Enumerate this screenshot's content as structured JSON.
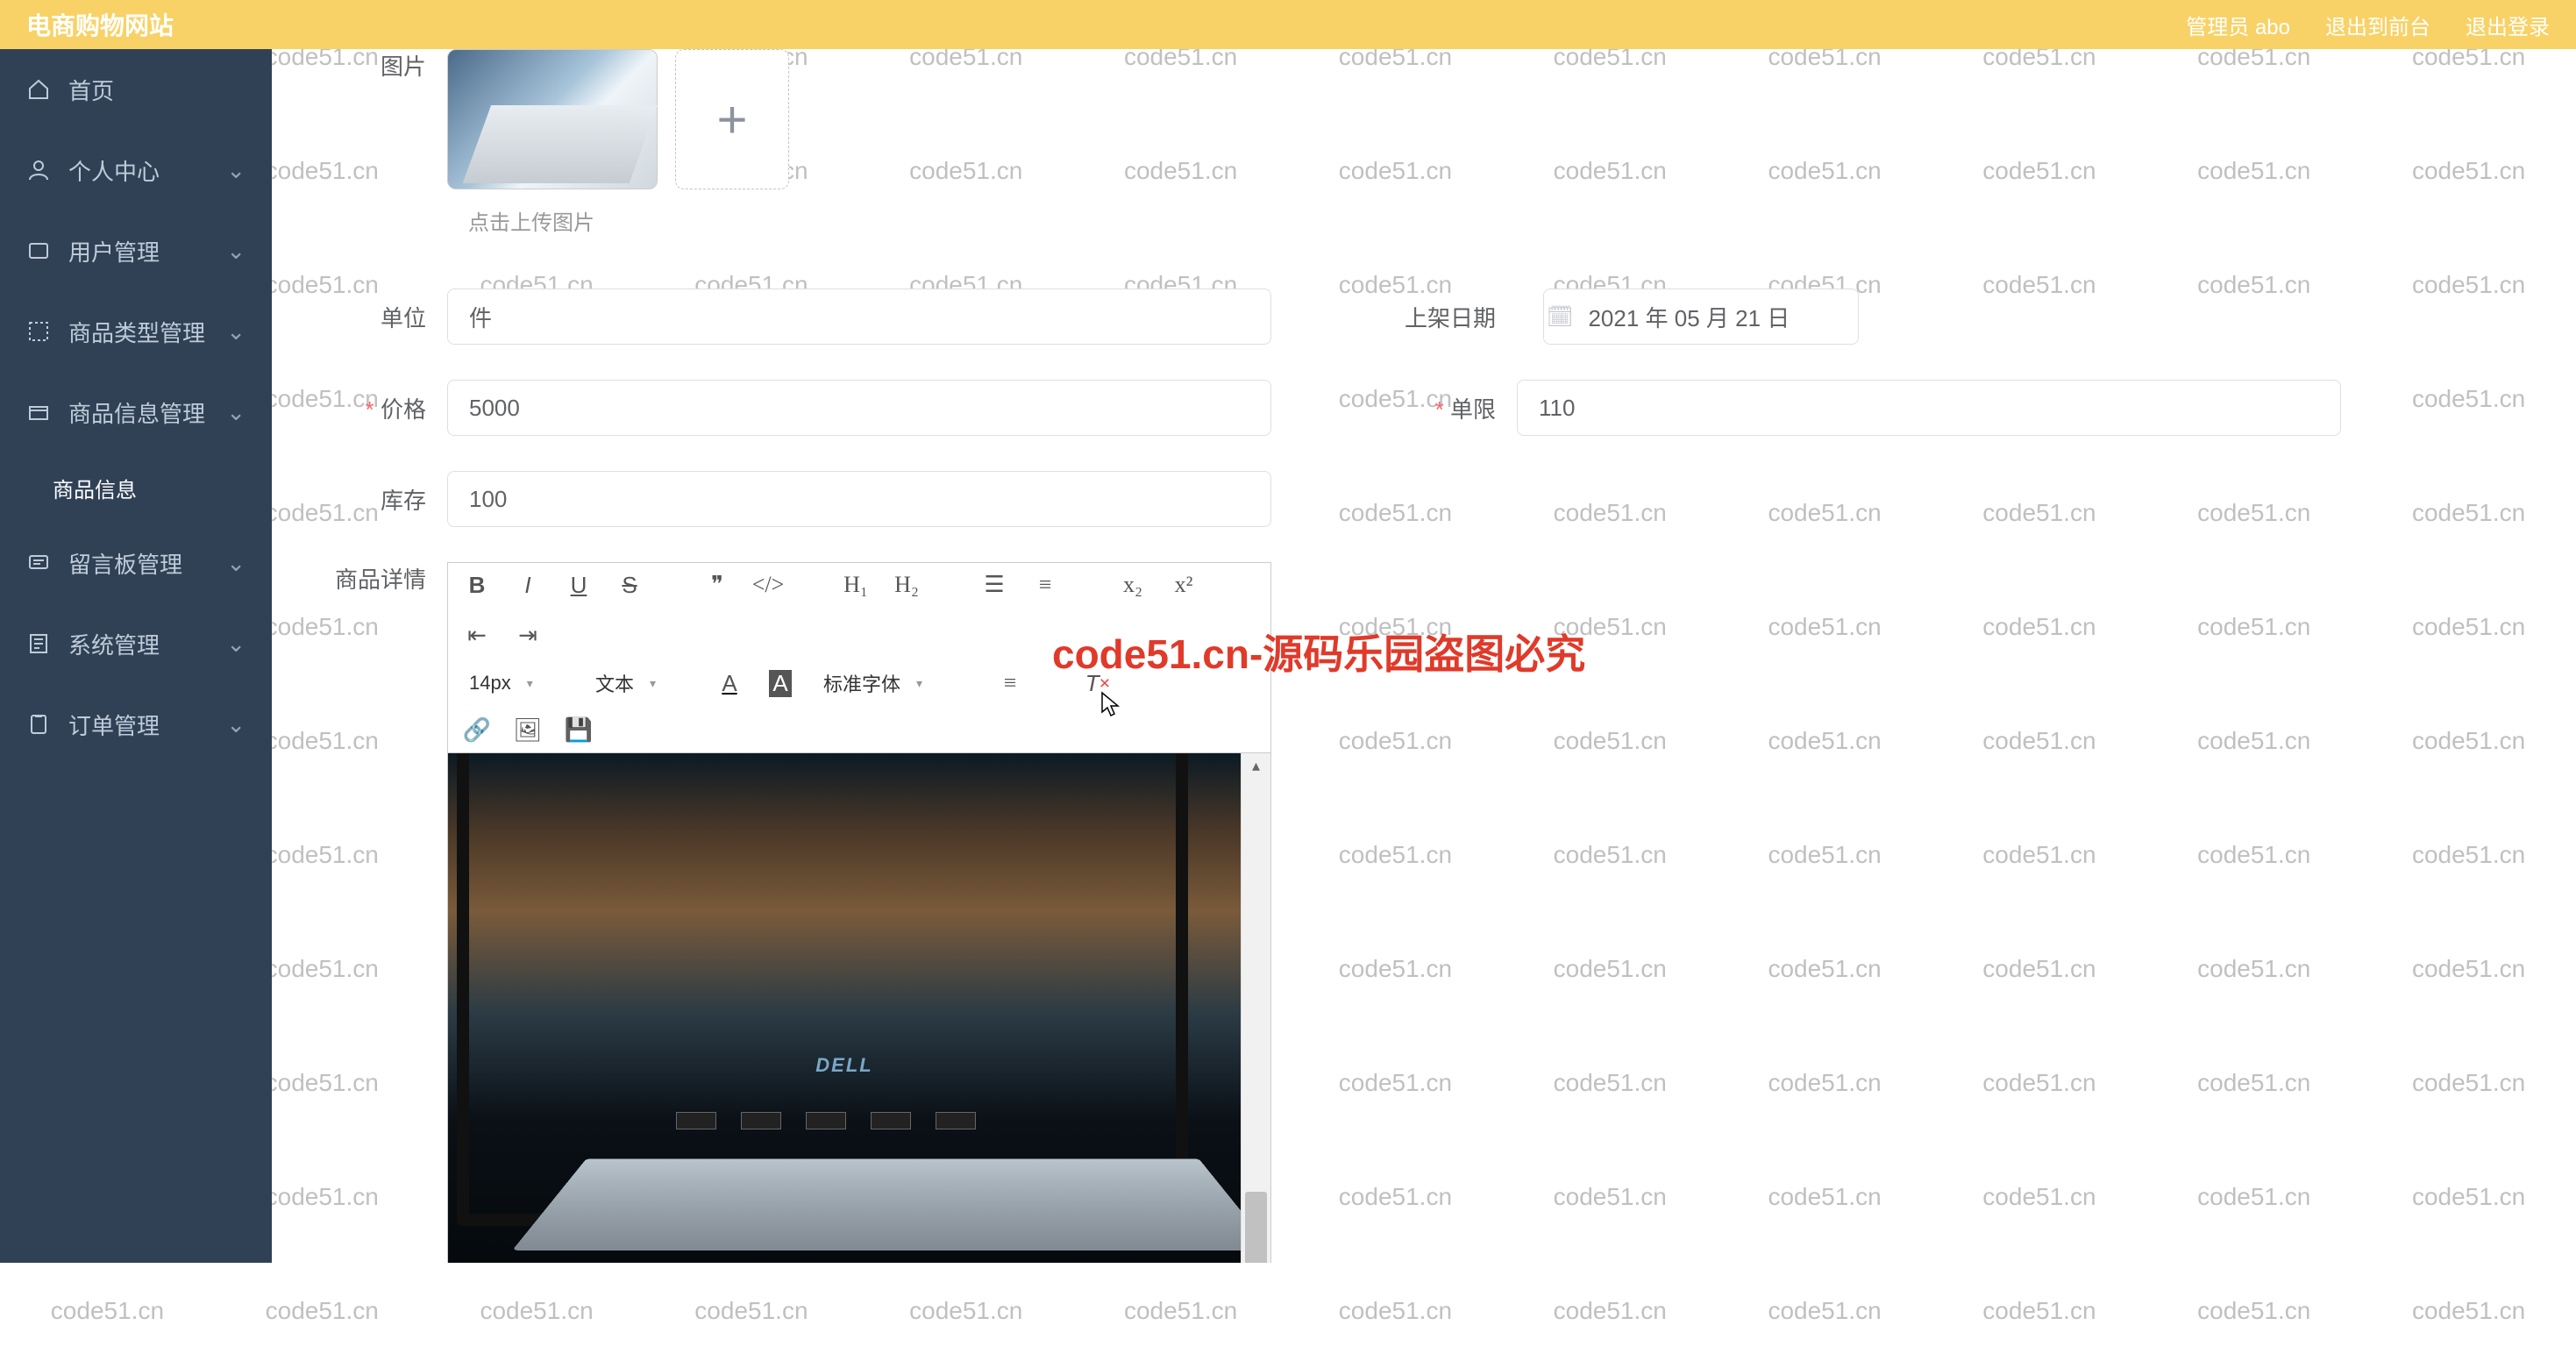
{
  "header": {
    "brand": "电商购物网站",
    "admin_label": "管理员 abo",
    "to_front": "退出到前台",
    "logout": "退出登录"
  },
  "sidebar": {
    "home": "首页",
    "personal": "个人中心",
    "user_mgmt": "用户管理",
    "cat_mgmt": "商品类型管理",
    "prod_mgmt": "商品信息管理",
    "prod_info": "商品信息",
    "msg_mgmt": "留言板管理",
    "sys_mgmt": "系统管理",
    "order_mgmt": "订单管理"
  },
  "form": {
    "image_label": "图片",
    "upload_hint": "点击上传图片",
    "unit_label": "单位",
    "unit_value": "件",
    "date_label": "上架日期",
    "date_value": "2021 年 05 月 21 日",
    "price_label": "价格",
    "price_value": "5000",
    "limit_label": "单限",
    "limit_value": "110",
    "stock_label": "库存",
    "stock_value": "100",
    "detail_label": "商品详情"
  },
  "editor": {
    "font_size": "14px",
    "block": "文本",
    "font_family": "标准字体",
    "laptop_brand": "DELL"
  },
  "watermark": {
    "text": "code51.cn",
    "red_text": "code51.cn-源码乐园盗图必究"
  }
}
